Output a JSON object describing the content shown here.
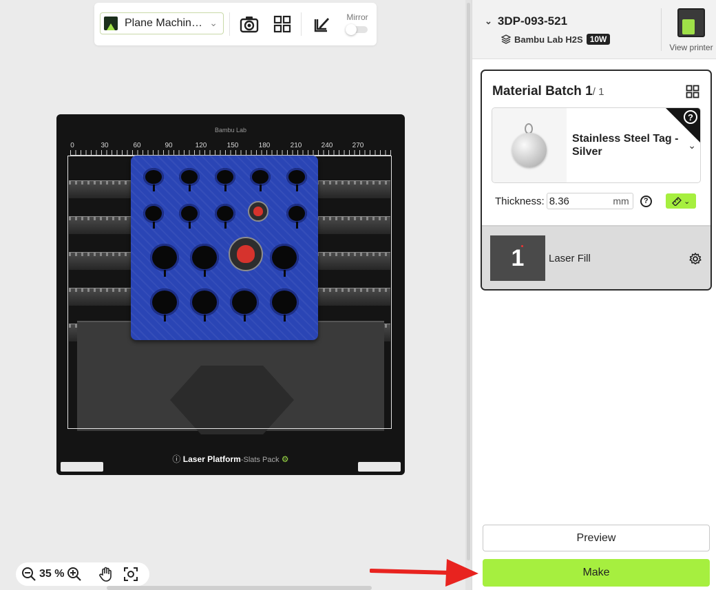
{
  "toolbar": {
    "mode_label": "Plane Machin…",
    "mode_icon": "laser-plane-icon",
    "camera_icon": "camera-icon",
    "arrange_icon": "grid-icon",
    "edit_icon": "edit-icon",
    "mirror_label": "Mirror",
    "mirror_on": false
  },
  "bed": {
    "brand": "Bambu Lab",
    "ruler": [
      "0",
      "30",
      "60",
      "90",
      "120",
      "150",
      "180",
      "210",
      "240",
      "270"
    ],
    "platform_label": "Laser Platform",
    "platform_sub": "-Slats Pack"
  },
  "zoom": {
    "value": "35 %"
  },
  "printer": {
    "id": "3DP-093-521",
    "model": "Bambu Lab H2S",
    "laser_power": "10W",
    "view_label": "View printer"
  },
  "batch": {
    "title": "Material Batch 1",
    "count": "/ 1",
    "material_name": "Stainless Steel Tag - Silver",
    "thickness_label": "Thickness:",
    "thickness_value": "8.36",
    "thickness_unit": "mm",
    "fill_number": "1",
    "fill_label": "Laser Fill"
  },
  "actions": {
    "preview_label": "Preview",
    "make_label": "Make"
  },
  "colors": {
    "accent": "#a6ef3f",
    "jig_blue": "#2a45b5",
    "annotation_arrow": "#e8231f"
  }
}
